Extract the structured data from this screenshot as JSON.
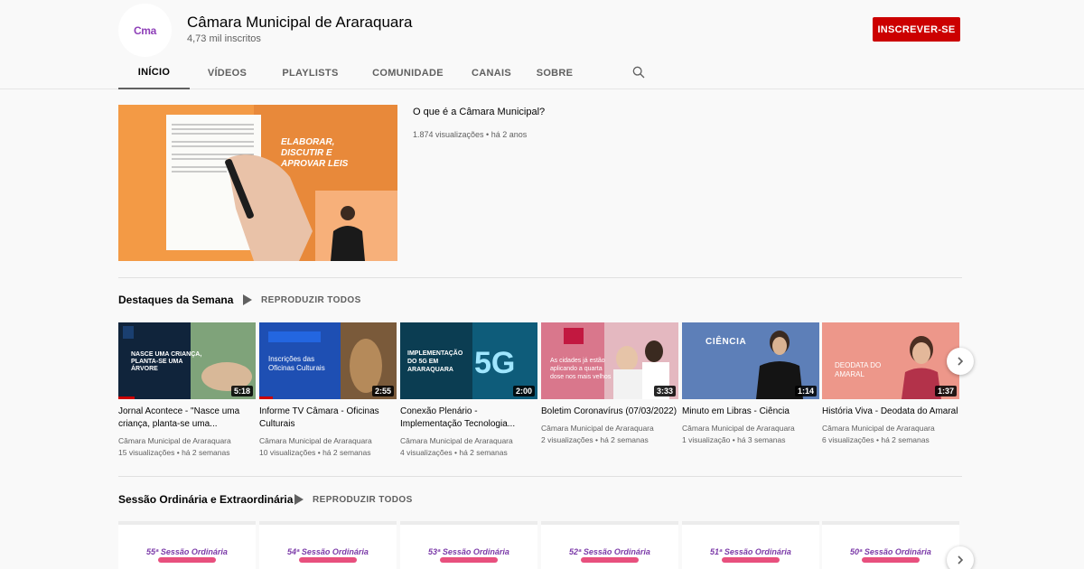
{
  "channel": {
    "logo_text": "Cma",
    "name": "Câmara Municipal de Araraquara",
    "subscribers": "4,73 mil inscritos",
    "subscribe_label": "INSCREVER-SE"
  },
  "tabs": [
    {
      "label": "INÍCIO",
      "active": true
    },
    {
      "label": "VÍDEOS",
      "active": false
    },
    {
      "label": "PLAYLISTS",
      "active": false
    },
    {
      "label": "COMUNIDADE",
      "active": false
    },
    {
      "label": "CANAIS",
      "active": false
    },
    {
      "label": "SOBRE",
      "active": false
    }
  ],
  "featured": {
    "title": "O que é a Câmara Municipal?",
    "meta": "1.874 visualizações • há 2 anos",
    "overlay_text": [
      "ELABORAR,",
      "DISCUTIR E",
      "APROVAR LEIS"
    ]
  },
  "shelf1": {
    "title": "Destaques da Semana",
    "play_all": "REPRODUZIR TODOS",
    "videos": [
      {
        "title": "Jornal Acontece - \"Nasce uma criança, planta-se uma...",
        "channel": "Câmara Municipal de Araraquara",
        "meta": "15 visualizações • há 2 semanas",
        "duration": "5:18",
        "thumb_text": "NASCE UMA CRIANÇA, PLANTA-SE UMA ÁRVORE",
        "progress": 0.12
      },
      {
        "title": "Informe TV Câmara - Oficinas Culturais",
        "channel": "Câmara Municipal de Araraquara",
        "meta": "10 visualizações • há 2 semanas",
        "duration": "2:55",
        "thumb_text": "Inscrições das Oficinas Culturais",
        "progress": 0.1
      },
      {
        "title": "Conexão Plenário - Implementação Tecnologia...",
        "channel": "Câmara Municipal de Araraquara",
        "meta": "4 visualizações • há 2 semanas",
        "duration": "2:00",
        "thumb_text": "IMPLEMENTAÇÃO DO 5G EM ARARAQUARA",
        "progress": 0
      },
      {
        "title": "Boletim Coronavírus (07/03/2022)",
        "channel": "Câmara Municipal de Araraquara",
        "meta": "2 visualizações • há 2 semanas",
        "duration": "3:33",
        "thumb_text": "As cidades já estão aplicando a quarta dose nos mais velhos",
        "progress": 0
      },
      {
        "title": "Minuto em Libras - Ciência",
        "channel": "Câmara Municipal de Araraquara",
        "meta": "1 visualização • há 3 semanas",
        "duration": "1:14",
        "thumb_text": "CIÊNCIA",
        "progress": 0
      },
      {
        "title": "História Viva - Deodata do Amaral",
        "channel": "Câmara Municipal de Araraquara",
        "meta": "6 visualizações • há 2 semanas",
        "duration": "1:37",
        "thumb_text": "DEODATA DO AMARAL",
        "progress": 0
      }
    ]
  },
  "shelf2": {
    "title": "Sessão Ordinária e Extraordinária",
    "play_all": "REPRODUZIR TODOS",
    "sessions": [
      {
        "label": "55ª Sessão Ordinária"
      },
      {
        "label": "54ª Sessão Ordinária"
      },
      {
        "label": "53ª Sessão Ordinária"
      },
      {
        "label": "52ª Sessão Ordinária"
      },
      {
        "label": "51ª Sessão Ordinária"
      },
      {
        "label": "50ª Sessão Ordinária"
      }
    ]
  },
  "colors": {
    "subscribe": "#cc0000",
    "progress": "#cc0000",
    "featured_bg": "#f39a45"
  }
}
